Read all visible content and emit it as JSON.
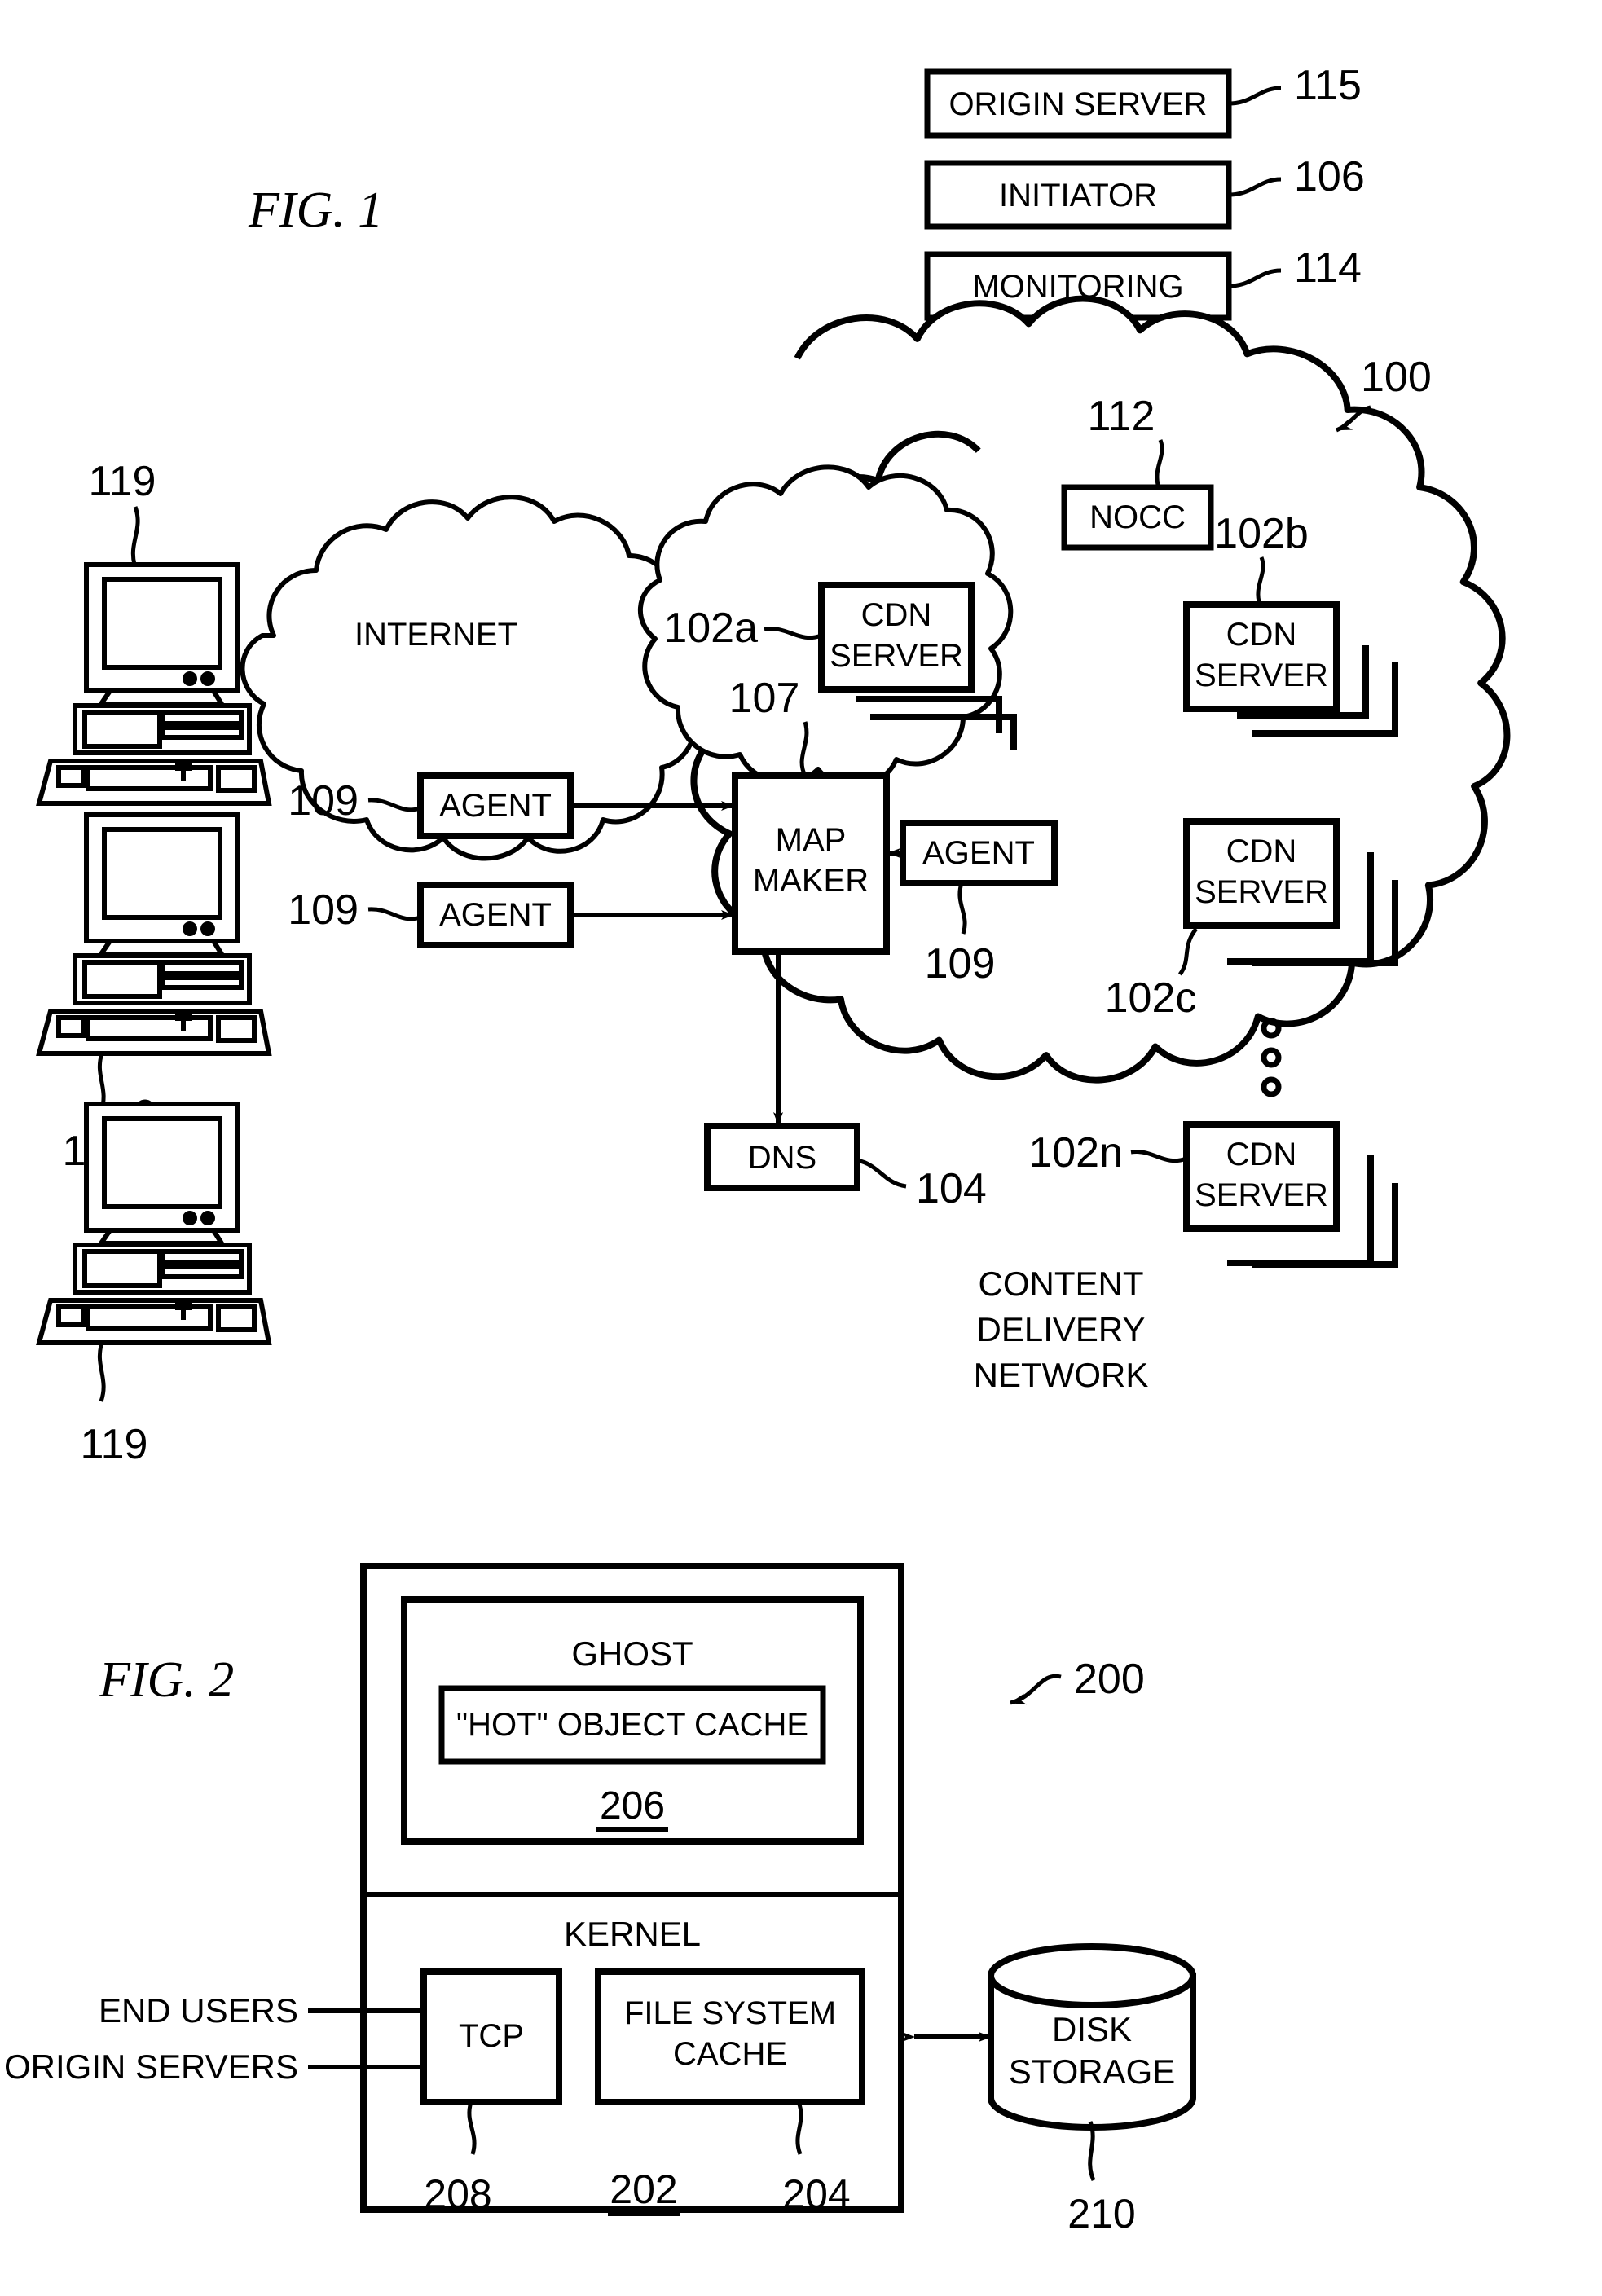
{
  "document": {
    "kind": "patent-drawing-sheet",
    "figures": [
      "FIG. 1",
      "FIG. 2"
    ]
  },
  "fig1": {
    "title": "FIG. 1",
    "top_boxes": [
      {
        "label": "ORIGIN SERVER",
        "ref": "115"
      },
      {
        "label": "INITIATOR",
        "ref": "106"
      },
      {
        "label": "MONITORING",
        "ref": "114"
      }
    ],
    "cdn_cloud": {
      "ref": "100",
      "caption_lines": [
        "CONTENT",
        "DELIVERY",
        "NETWORK"
      ]
    },
    "internet_cloud": {
      "label": "INTERNET"
    },
    "nocc": {
      "label": "NOCC",
      "ref": "112"
    },
    "map_maker": {
      "label_line1": "MAP",
      "label_line2": "MAKER",
      "ref": "107"
    },
    "dns": {
      "label": "DNS",
      "ref": "104"
    },
    "agents": [
      {
        "label": "AGENT",
        "ref": "109"
      },
      {
        "label": "AGENT",
        "ref": "109"
      },
      {
        "label": "AGENT",
        "ref": "109"
      }
    ],
    "cdn_servers": [
      {
        "label_line1": "CDN",
        "label_line2": "SERVER",
        "ref": "102a"
      },
      {
        "label_line1": "CDN",
        "label_line2": "SERVER",
        "ref": "102b"
      },
      {
        "label_line1": "CDN",
        "label_line2": "SERVER",
        "ref": "102c"
      },
      {
        "label_line1": "CDN",
        "label_line2": "SERVER",
        "ref": "102n"
      }
    ],
    "clients": [
      {
        "ref": "119"
      },
      {
        "ref": "119"
      },
      {
        "ref": "119"
      }
    ],
    "ellipsis_glyph": "vertical-dots"
  },
  "fig2": {
    "title": "FIG. 2",
    "ref": "200",
    "ghost": {
      "label": "GHOST",
      "hot_object_cache": "\"HOT\" OBJECT CACHE",
      "ref": "206"
    },
    "kernel": {
      "label": "KERNEL",
      "tcp": {
        "label": "TCP",
        "ref": "208"
      },
      "file_system_cache": {
        "label_line1": "FILE SYSTEM",
        "label_line2": "CACHE",
        "ref": "204"
      },
      "ref": "202"
    },
    "inputs": [
      {
        "label": "END USERS"
      },
      {
        "label": "ORIGIN SERVERS"
      }
    ],
    "disk_storage": {
      "label_line1": "DISK",
      "label_line2": "STORAGE",
      "ref": "210"
    }
  },
  "style": {
    "ink": "#000000",
    "paper": "#ffffff"
  }
}
